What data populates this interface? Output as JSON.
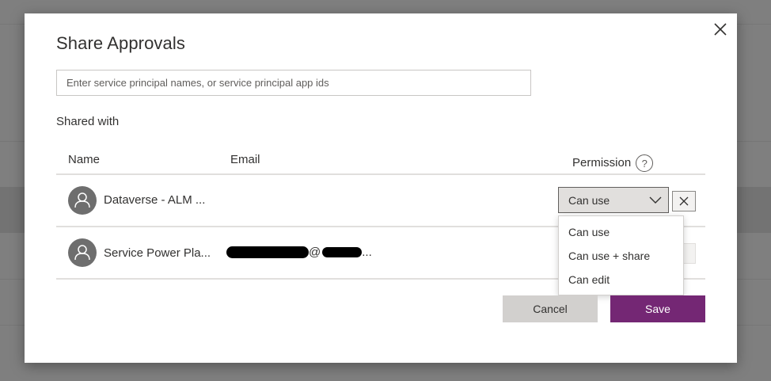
{
  "dialog": {
    "title": "Share Approvals",
    "search_placeholder": "Enter service principal names, or service principal app ids",
    "shared_with_label": "Shared with",
    "columns": {
      "name": "Name",
      "email": "Email",
      "permission": "Permission",
      "help_glyph": "?"
    },
    "rows": [
      {
        "name": "Dataverse - ALM ...",
        "email": ""
      },
      {
        "name": "Service Power Pla...",
        "email_at": "@",
        "email_suffix": "..."
      }
    ],
    "permission_select": {
      "value": "Can use"
    },
    "permission_options": [
      "Can use",
      "Can use + share",
      "Can edit"
    ],
    "cancel_label": "Cancel",
    "save_label": "Save"
  },
  "colors": {
    "save_button": "#742774",
    "cancel_button": "#d2d0ce",
    "overlay": "#7f7f7f",
    "avatar": "#6e6e6e"
  },
  "icons": [
    "close-icon",
    "help-icon",
    "person-icon",
    "chevron-down-icon",
    "remove-icon"
  ]
}
